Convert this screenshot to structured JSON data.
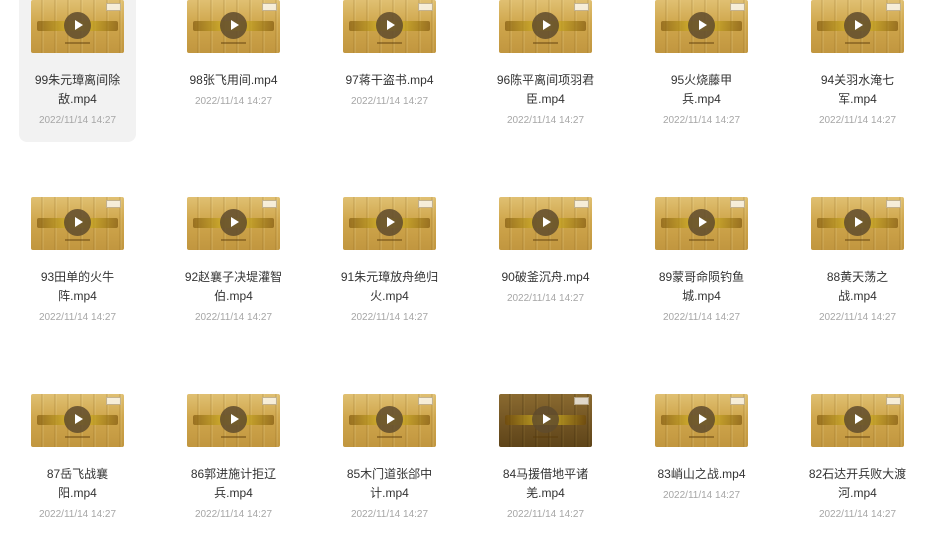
{
  "files": [
    {
      "name": "99朱元璋离间除敌.mp4",
      "lines": [
        "99朱元璋离间除",
        "敌.mp4"
      ],
      "date": "2022/11/14 14:27",
      "selected": true
    },
    {
      "name": "98张飞用间.mp4",
      "lines": [
        "98张飞用间.mp4"
      ],
      "date": "2022/11/14 14:27"
    },
    {
      "name": "97蒋干盗书.mp4",
      "lines": [
        "97蒋干盗书.mp4"
      ],
      "date": "2022/11/14 14:27"
    },
    {
      "name": "96陈平离间项羽君臣.mp4",
      "lines": [
        "96陈平离间项羽君",
        "臣.mp4"
      ],
      "date": "2022/11/14 14:27"
    },
    {
      "name": "95火烧藤甲兵.mp4",
      "lines": [
        "95火烧藤甲",
        "兵.mp4"
      ],
      "date": "2022/11/14 14:27"
    },
    {
      "name": "94关羽水淹七军.mp4",
      "lines": [
        "94关羽水淹七",
        "军.mp4"
      ],
      "date": "2022/11/14 14:27"
    },
    {
      "name": "93田单的火牛阵.mp4",
      "lines": [
        "93田单的火牛",
        "阵.mp4"
      ],
      "date": "2022/11/14 14:27"
    },
    {
      "name": "92赵襄子决堤灌智伯.mp4",
      "lines": [
        "92赵襄子决堤灌智",
        "伯.mp4"
      ],
      "date": "2022/11/14 14:27"
    },
    {
      "name": "91朱元璋放舟绝归火.mp4",
      "lines": [
        "91朱元璋放舟绝归",
        "火.mp4"
      ],
      "date": "2022/11/14 14:27"
    },
    {
      "name": "90破釜沉舟.mp4",
      "lines": [
        "90破釜沉舟.mp4"
      ],
      "date": "2022/11/14 14:27"
    },
    {
      "name": "89蒙哥命陨钓鱼城.mp4",
      "lines": [
        "89蒙哥命陨钓鱼",
        "城.mp4"
      ],
      "date": "2022/11/14 14:27"
    },
    {
      "name": "88黄天荡之战.mp4",
      "lines": [
        "88黄天荡之",
        "战.mp4"
      ],
      "date": "2022/11/14 14:27"
    },
    {
      "name": "87岳飞战襄阳.mp4",
      "lines": [
        "87岳飞战襄",
        "阳.mp4"
      ],
      "date": "2022/11/14 14:27"
    },
    {
      "name": "86郭进施计拒辽兵.mp4",
      "lines": [
        "86郭进施计拒辽",
        "兵.mp4"
      ],
      "date": "2022/11/14 14:27"
    },
    {
      "name": "85木门道张郃中计.mp4",
      "lines": [
        "85木门道张郃中",
        "计.mp4"
      ],
      "date": "2022/11/14 14:27"
    },
    {
      "name": "84马援借地平诸羌.mp4",
      "lines": [
        "84马援借地平诸",
        "羌.mp4"
      ],
      "date": "2022/11/14 14:27",
      "dark": true
    },
    {
      "name": "83峭山之战.mp4",
      "lines": [
        "83峭山之战.mp4"
      ],
      "date": "2022/11/14 14:27"
    },
    {
      "name": "82石达开兵败大渡河.mp4",
      "lines": [
        "82石达开兵败大渡",
        "河.mp4"
      ],
      "date": "2022/11/14 14:27"
    }
  ],
  "icons": {
    "play": "play-icon"
  }
}
